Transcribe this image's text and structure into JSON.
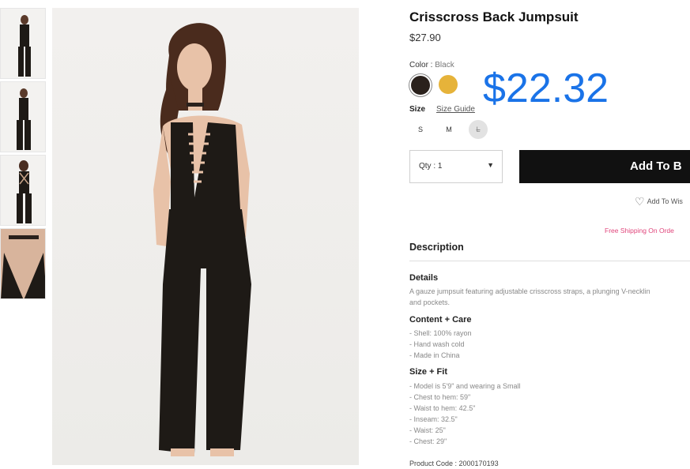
{
  "product": {
    "title": "Crisscross Back Jumpsuit",
    "price": "$27.90",
    "sale_price": "$22.32"
  },
  "color": {
    "label": "Color :",
    "selected": "Black",
    "options": [
      {
        "name": "Black",
        "hex": "#2a211c"
      },
      {
        "name": "Mustard",
        "hex": "#e6b33a"
      }
    ]
  },
  "size": {
    "label": "Size",
    "guide_label": "Size Guide",
    "options": [
      "S",
      "M",
      "L"
    ]
  },
  "actions": {
    "qty_label": "Qty : 1",
    "add_to_bag": "Add To B",
    "add_to_wishlist": "Add To Wis",
    "free_shipping": "Free Shipping On Orde"
  },
  "description": {
    "heading": "Description",
    "details_heading": "Details",
    "details_lines": [
      "A gauze jumpsuit featuring adjustable crisscross straps, a plunging V-necklin",
      "and pockets."
    ],
    "content_heading": "Content + Care",
    "content_items": [
      "- Shell: 100% rayon",
      "- Hand wash cold",
      "- Made in China"
    ],
    "fit_heading": "Size + Fit",
    "fit_items": [
      "- Model is 5'9\" and wearing a Small",
      "- Chest to hem: 59\"",
      "- Waist to hem: 42.5\"",
      "- Inseam: 32.5\"",
      "- Waist: 25\"",
      "- Chest: 29\""
    ],
    "product_code": "Product Code : 2000170193"
  },
  "colors": {
    "sale_price": "#1a73e8",
    "add_to_bag_bg": "#111111",
    "free_shipping": "#e0457b"
  }
}
